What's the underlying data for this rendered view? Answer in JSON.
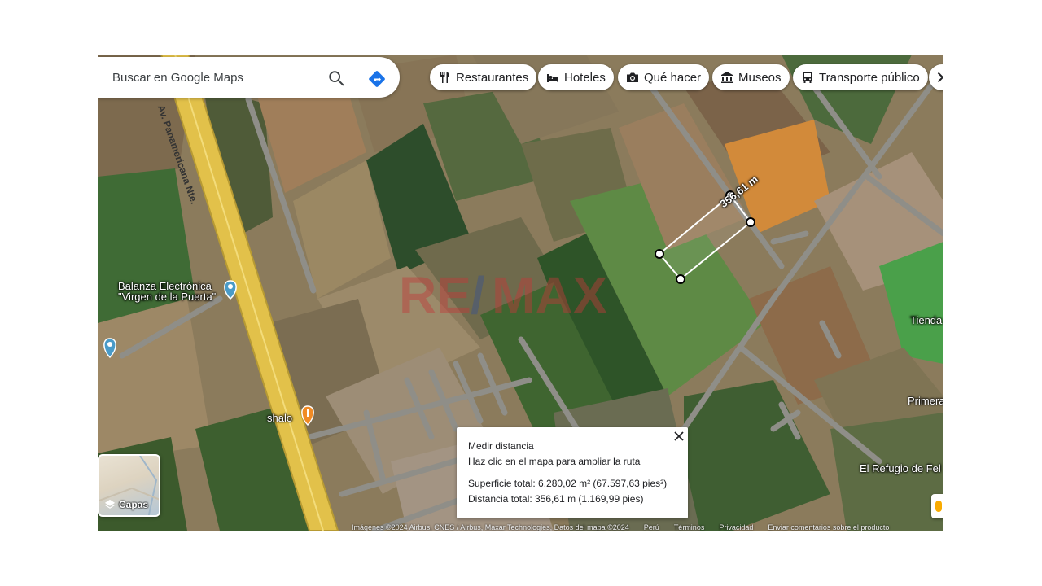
{
  "search": {
    "placeholder": "Buscar en Google Maps",
    "search_icon": "search-icon",
    "directions_icon": "directions-icon"
  },
  "chips": [
    {
      "label": "Restaurantes",
      "icon": "fork-knife-icon"
    },
    {
      "label": "Hoteles",
      "icon": "bed-icon"
    },
    {
      "label": "Qué hacer",
      "icon": "camera-icon"
    },
    {
      "label": "Museos",
      "icon": "museum-icon"
    },
    {
      "label": "Transporte público",
      "icon": "bus-icon"
    }
  ],
  "map": {
    "road_label": "Av. Panamericana Nte.",
    "places": [
      {
        "name": "Balanza Electrónica",
        "name2": "\"Virgen de la Puerta\""
      },
      {
        "name": "shalo"
      },
      {
        "name": "Tienda"
      },
      {
        "name": "Primera"
      },
      {
        "name": "El Refugio de Fel"
      }
    ],
    "watermark": "RE/MAX",
    "measure_label": "356,61 m"
  },
  "layers": {
    "label": "Capas"
  },
  "measure_panel": {
    "title": "Medir distancia",
    "hint": "Haz clic en el mapa para ampliar la ruta",
    "area": "Superficie total: 6.280,02 m² (67.597,63 pies²)",
    "distance": "Distancia total: 356,61 m (1.169,99 pies)"
  },
  "footer": {
    "imagery": "Imágenes ©2024 Airbus, CNES / Airbus, Maxar Technologies, Datos del mapa ©2024",
    "country": "Perú",
    "terms": "Términos",
    "privacy": "Privacidad",
    "feedback": "Enviar comentarios sobre el producto"
  },
  "colors": {
    "accent": "#1a73e8",
    "road": "#e8c64a",
    "pin_blue": "#4a9bc8",
    "pin_orange": "#f08a24"
  }
}
